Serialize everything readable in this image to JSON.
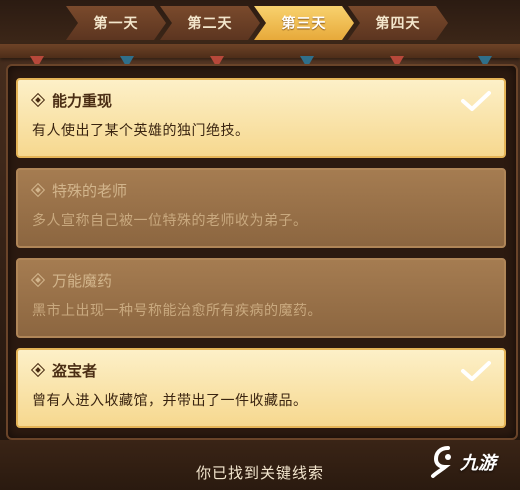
{
  "tabs": [
    {
      "label": "第一天",
      "active": false
    },
    {
      "label": "第二天",
      "active": false
    },
    {
      "label": "第三天",
      "active": true
    },
    {
      "label": "第四天",
      "active": false
    }
  ],
  "clues": [
    {
      "title": "能力重现",
      "desc": "有人使出了某个英雄的独门绝技。",
      "unlocked": true
    },
    {
      "title": "特殊的老师",
      "desc": "多人宣称自己被一位特殊的老师收为弟子。",
      "unlocked": false
    },
    {
      "title": "万能魔药",
      "desc": "黑市上出现一种号称能治愈所有疾病的魔药。",
      "unlocked": false
    },
    {
      "title": "盗宝者",
      "desc": "曾有人进入收藏馆，并带出了一件收藏品。",
      "unlocked": true
    }
  ],
  "footer": {
    "status_text": "你已找到关键线索"
  },
  "watermark": {
    "text": "九游"
  },
  "colors": {
    "active_tab": "#f0b94a",
    "unlocked_card": "#f9e4a8",
    "locked_card": "#9a7249",
    "check": "#ffffff"
  }
}
